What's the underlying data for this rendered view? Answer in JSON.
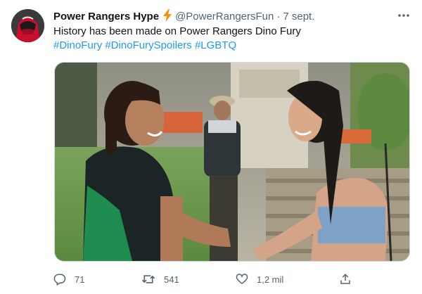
{
  "tweet": {
    "author_name": "Power Rangers Hype",
    "author_badge_icon": "lightning-bolt-icon",
    "author_handle": "@PowerRangersFun",
    "separator": "·",
    "date": "7 sept.",
    "more_icon": "more-horizontal-icon",
    "text": "History has been made on Power Rangers Dino Fury",
    "hashtags": [
      "#DinoFury",
      "#DinoFurySpoilers",
      "#LGBTQ"
    ],
    "media_description_icon": "photo-image"
  },
  "actions": {
    "reply": {
      "icon": "reply-icon",
      "count": "71"
    },
    "retweet": {
      "icon": "retweet-icon",
      "count": "541"
    },
    "like": {
      "icon": "heart-icon",
      "count": "1,2 mil"
    },
    "share": {
      "icon": "share-icon"
    }
  },
  "colors": {
    "text": "#0f1419",
    "muted": "#536471",
    "link": "#1d9bf0",
    "bolt": "#f4900c",
    "border": "#cfd9de"
  }
}
